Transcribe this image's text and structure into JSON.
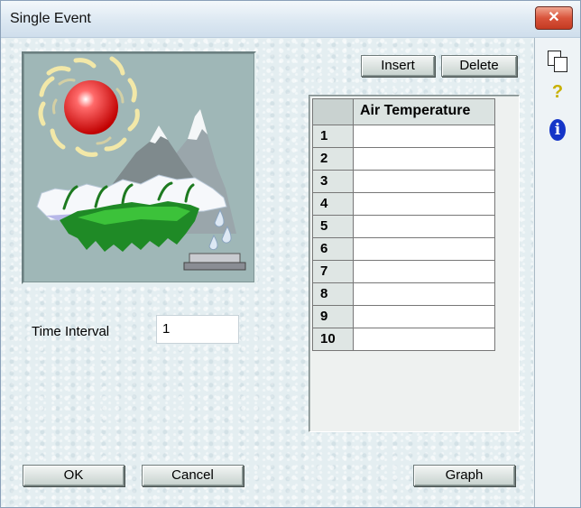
{
  "window": {
    "title": "Single Event",
    "close_glyph": "✕"
  },
  "toolbar": {
    "insert_label": "Insert",
    "delete_label": "Delete"
  },
  "grid": {
    "column_header": "Air Temperature",
    "rows": [
      {
        "label": "1",
        "value": ""
      },
      {
        "label": "2",
        "value": ""
      },
      {
        "label": "3",
        "value": ""
      },
      {
        "label": "4",
        "value": ""
      },
      {
        "label": "5",
        "value": ""
      },
      {
        "label": "6",
        "value": ""
      },
      {
        "label": "7",
        "value": ""
      },
      {
        "label": "8",
        "value": ""
      },
      {
        "label": "9",
        "value": ""
      },
      {
        "label": "10",
        "value": ""
      }
    ]
  },
  "time_interval": {
    "label": "Time Interval",
    "value": "1"
  },
  "footer": {
    "ok_label": "OK",
    "cancel_label": "Cancel",
    "graph_label": "Graph"
  },
  "side_panel": {
    "icons": [
      "copy-icon",
      "help-icon",
      "info-icon"
    ],
    "help_glyph": "?",
    "info_glyph": "i"
  },
  "colors": {
    "close_red": "#d9543b",
    "info_blue": "#1535c8",
    "help_yellow": "#c8b000"
  }
}
